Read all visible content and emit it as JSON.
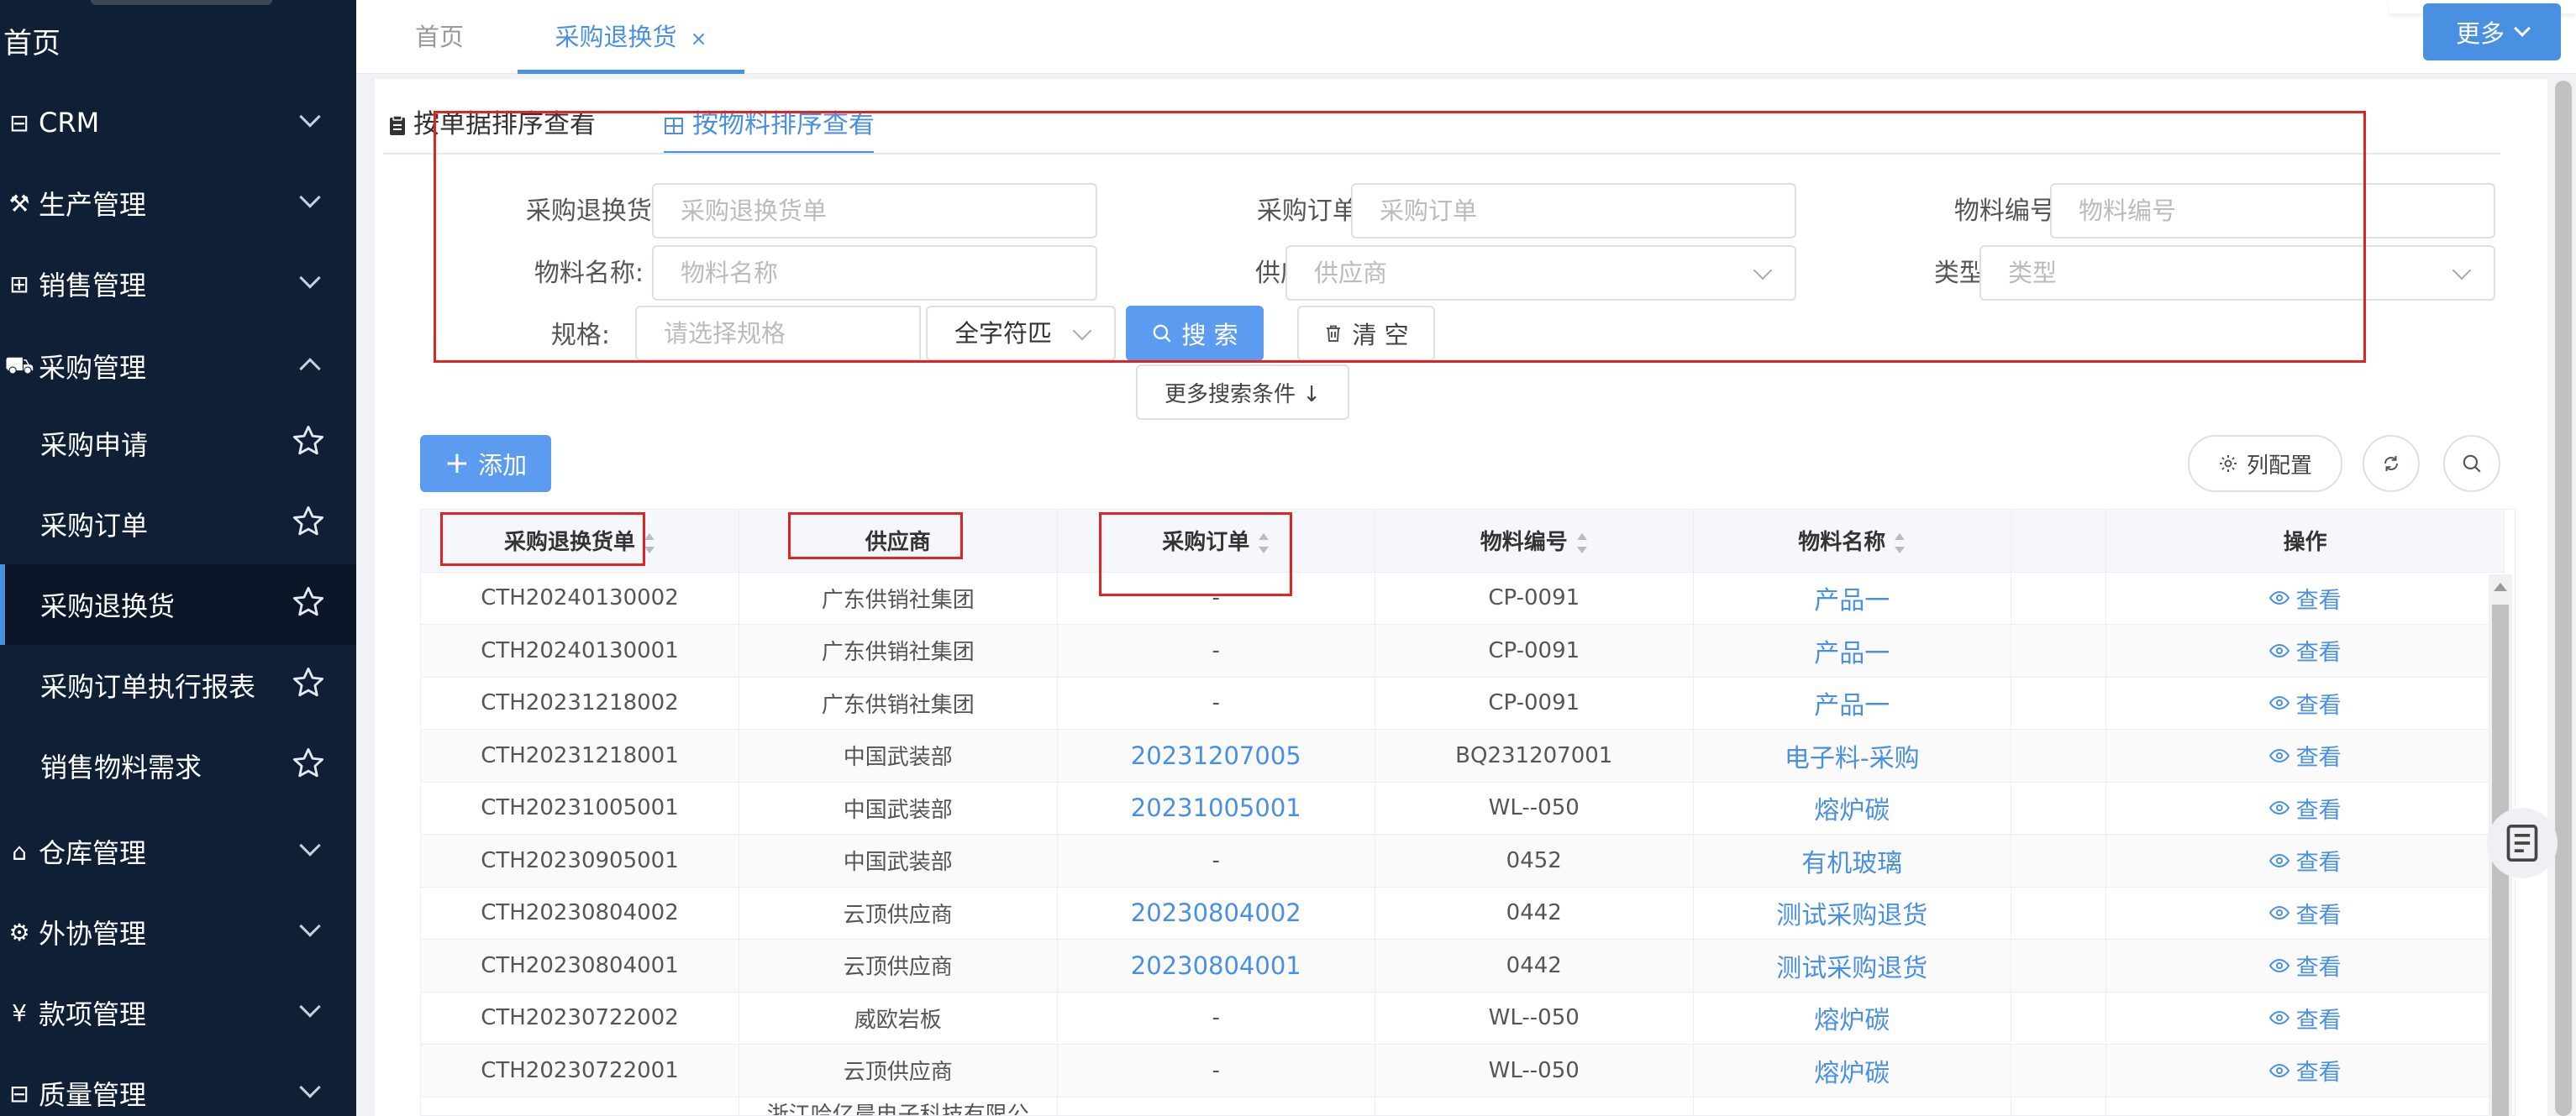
{
  "sidebar": {
    "home": "首页",
    "menus": [
      {
        "icon": "monitor-icon",
        "glyph": "⊟",
        "label": "CRM"
      },
      {
        "icon": "production-icon",
        "glyph": "⚒",
        "label": "生产管理"
      },
      {
        "icon": "sales-icon",
        "glyph": "⊞",
        "label": "销售管理"
      },
      {
        "icon": "cart-icon",
        "glyph": "⛟",
        "label": "采购管理"
      }
    ],
    "submenus": [
      {
        "label": "采购申请"
      },
      {
        "label": "采购订单"
      },
      {
        "label": "采购退换货"
      },
      {
        "label": "采购订单执行报表"
      },
      {
        "label": "销售物料需求"
      }
    ],
    "menus_after": [
      {
        "icon": "warehouse-icon",
        "glyph": "⌂",
        "label": "仓库管理"
      },
      {
        "icon": "outsource-icon",
        "glyph": "⚙",
        "label": "外协管理"
      },
      {
        "icon": "yuan-icon",
        "glyph": "¥",
        "label": "款项管理"
      },
      {
        "icon": "quality-icon",
        "glyph": "⊟",
        "label": "质量管理"
      }
    ]
  },
  "tabs": {
    "home": "首页",
    "current": "采购退换货",
    "close": "×",
    "more": "更多"
  },
  "view_tabs": {
    "by_document": "按单据排序查看",
    "by_material": "按物料排序查看"
  },
  "filters": {
    "return_no": {
      "label": "采购退换货单:",
      "placeholder": "采购退换货单"
    },
    "order_no": {
      "label": "采购订单:",
      "placeholder": "采购订单"
    },
    "material_code": {
      "label": "物料编号:",
      "placeholder": "物料编号"
    },
    "material_name": {
      "label": "物料名称:",
      "placeholder": "物料名称"
    },
    "supplier": {
      "label": "供应商:",
      "placeholder": "供应商"
    },
    "type": {
      "label": "类型:",
      "placeholder": "类型"
    },
    "spec": {
      "label": "规格:",
      "placeholder": "请选择规格",
      "match_mode": "全字符匹"
    }
  },
  "buttons": {
    "search": "搜 索",
    "clear": "清 空",
    "more_conditions": "更多搜索条件 ↓",
    "add": "添加",
    "column_config": "列配置"
  },
  "table": {
    "columns": [
      "采购退换货单",
      "供应商",
      "采购订单",
      "物料编号",
      "物料名称",
      "",
      "操作"
    ],
    "view_label": "查看",
    "rows": [
      {
        "return_no": "CTH20240130002",
        "supplier": "广东供销社集团",
        "order_no": "-",
        "material_code": "CP-0091",
        "material_name": "产品一"
      },
      {
        "return_no": "CTH20240130001",
        "supplier": "广东供销社集团",
        "order_no": "-",
        "material_code": "CP-0091",
        "material_name": "产品一"
      },
      {
        "return_no": "CTH20231218002",
        "supplier": "广东供销社集团",
        "order_no": "-",
        "material_code": "CP-0091",
        "material_name": "产品一"
      },
      {
        "return_no": "CTH20231218001",
        "supplier": "中国武装部",
        "order_no": "20231207005",
        "material_code": "BQ231207001",
        "material_name": "电子料-采购"
      },
      {
        "return_no": "CTH20231005001",
        "supplier": "中国武装部",
        "order_no": "20231005001",
        "material_code": "WL--050",
        "material_name": "熔炉碳"
      },
      {
        "return_no": "CTH20230905001",
        "supplier": "中国武装部",
        "order_no": "-",
        "material_code": "0452",
        "material_name": "有机玻璃"
      },
      {
        "return_no": "CTH20230804002",
        "supplier": "云顶供应商",
        "order_no": "20230804002",
        "material_code": "0442",
        "material_name": "测试采购退货"
      },
      {
        "return_no": "CTH20230804001",
        "supplier": "云顶供应商",
        "order_no": "20230804001",
        "material_code": "0442",
        "material_name": "测试采购退货"
      },
      {
        "return_no": "CTH20230722002",
        "supplier": "威欧岩板",
        "order_no": "-",
        "material_code": "WL--050",
        "material_name": "熔炉碳"
      },
      {
        "return_no": "CTH20230722001",
        "supplier": "云顶供应商",
        "order_no": "-",
        "material_code": "WL--050",
        "material_name": "熔炉碳"
      },
      {
        "return_no": "",
        "supplier": "浙江哈亿晨电子科技有限公",
        "order_no": "",
        "material_code": "",
        "material_name": ""
      }
    ]
  },
  "colors": {
    "sidebar_bg": "#0f1f36",
    "accent": "#4a90e2",
    "highlight_border": "#e02424"
  }
}
